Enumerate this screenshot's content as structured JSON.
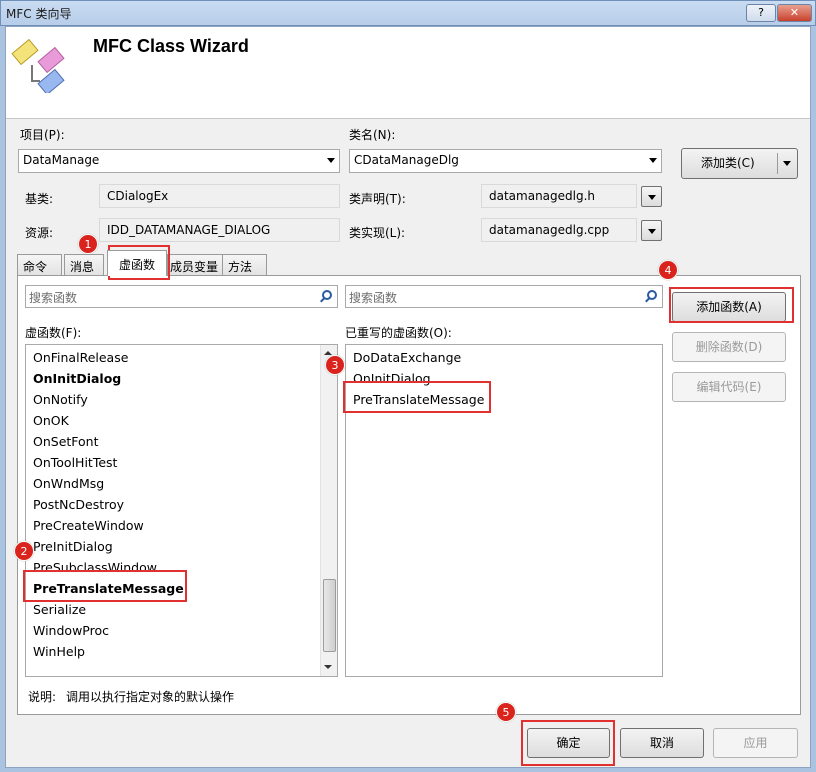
{
  "window": {
    "title": "MFC 类向导",
    "help": "?",
    "close": "✕"
  },
  "banner": {
    "title": "MFC Class Wizard"
  },
  "project": {
    "label": "项目(P):",
    "value": "DataManage"
  },
  "classname": {
    "label": "类名(N):",
    "value": "CDataManageDlg"
  },
  "add_class": {
    "label": "添加类(C)"
  },
  "base": {
    "label": "基类:",
    "value": "CDialogEx"
  },
  "decl": {
    "label": "类声明(T):",
    "value": "datamanagedlg.h"
  },
  "resource": {
    "label": "资源:",
    "value": "IDD_DATAMANAGE_DIALOG"
  },
  "impl": {
    "label": "类实现(L):",
    "value": "datamanagedlg.cpp"
  },
  "tabs": [
    "命令",
    "消息",
    "虚函数",
    "成员变量",
    "方法"
  ],
  "search": {
    "left_placeholder": "搜索函数",
    "right_placeholder": "搜索函数"
  },
  "vfuncs": {
    "label": "虚函数(F):",
    "items": [
      "OnFinalRelease",
      "OnInitDialog",
      "OnNotify",
      "OnOK",
      "OnSetFont",
      "OnToolHitTest",
      "OnWndMsg",
      "PostNcDestroy",
      "PreCreateWindow",
      "PreInitDialog",
      "PreSubclassWindow",
      "PreTranslateMessage",
      "Serialize",
      "WindowProc",
      "WinHelp"
    ]
  },
  "overridden": {
    "label": "已重写的虚函数(O):",
    "items": [
      "DoDataExchange",
      "OnInitDialog",
      "PreTranslateMessage"
    ]
  },
  "actions": {
    "add": "添加函数(A)",
    "delete": "删除函数(D)",
    "edit": "编辑代码(E)"
  },
  "desc": {
    "label": "说明:",
    "text": "调用以执行指定对象的默认操作"
  },
  "footer": {
    "ok": "确定",
    "cancel": "取消",
    "apply": "应用"
  },
  "badges": [
    "1",
    "2",
    "3",
    "4",
    "5"
  ],
  "colors": {
    "annotation_red": "#e03030",
    "badge_red": "#d9231c"
  }
}
